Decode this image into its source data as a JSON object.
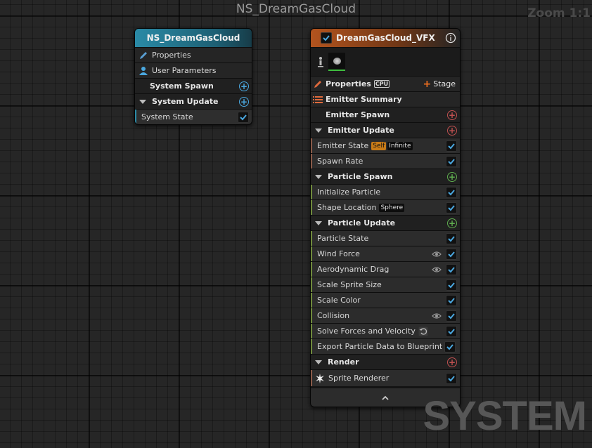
{
  "graph": {
    "title": "NS_DreamGasCloud",
    "zoom": "Zoom 1:1",
    "watermark": "SYSTEM"
  },
  "system_node": {
    "title": "NS_DreamGasCloud",
    "rows": {
      "properties": "Properties",
      "user_parameters": "User Parameters",
      "system_spawn": "System Spawn",
      "system_update": "System Update",
      "system_state": "System State"
    }
  },
  "emitter_node": {
    "title": "DreamGasCloud_VFX",
    "properties": "Properties",
    "sim_target": "CPU",
    "stage_button": "Stage",
    "summary": "Emitter Summary",
    "emitter_spawn": "Emitter Spawn",
    "emitter_update": "Emitter Update",
    "emitter_state": "Emitter State",
    "emitter_state_badges": [
      "Self",
      "Infinite"
    ],
    "spawn_rate": "Spawn Rate",
    "particle_spawn": "Particle Spawn",
    "initialize_particle": "Initialize Particle",
    "shape_location": "Shape Location",
    "shape_badge": "Sphere",
    "particle_update": "Particle Update",
    "update_modules": [
      "Particle State",
      "Wind Force",
      "Aerodynamic Drag",
      "Scale Sprite Size",
      "Scale Color",
      "Collision",
      "Solve Forces and Velocity",
      "Export Particle Data to Blueprint"
    ],
    "render": "Render",
    "sprite_renderer": "Sprite Renderer"
  },
  "colors": {
    "system_header_left": "#2a8aa6",
    "emitter_header_left": "#b3541e",
    "accent_check": "#4aa8e0",
    "spawn_bar": "#6f8a3c",
    "update_bar": "#8a5a48"
  }
}
